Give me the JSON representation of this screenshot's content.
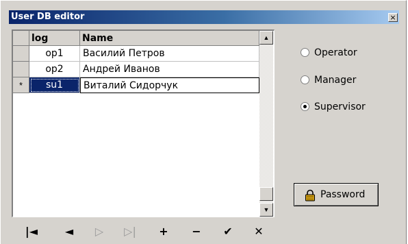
{
  "window": {
    "title": "User DB editor",
    "close_glyph": "×"
  },
  "grid": {
    "columns": [
      "log",
      "Name"
    ],
    "rows": [
      {
        "indicator": "",
        "log": "op1",
        "name": "Василий Петров"
      },
      {
        "indicator": "",
        "log": "op2",
        "name": "Андрей Иванов"
      },
      {
        "indicator": "*",
        "log": "su1",
        "name": "Виталий Сидорчук"
      }
    ],
    "selected_row": 2
  },
  "navigator": {
    "buttons": [
      {
        "name": "first-record-button",
        "glyph": "|◄",
        "enabled": true
      },
      {
        "name": "prior-record-button",
        "glyph": "◄",
        "enabled": true
      },
      {
        "name": "next-record-button",
        "glyph": "▷",
        "enabled": false
      },
      {
        "name": "last-record-button",
        "glyph": "▷|",
        "enabled": false
      },
      {
        "name": "insert-record-button",
        "glyph": "+",
        "enabled": true
      },
      {
        "name": "delete-record-button",
        "glyph": "−",
        "enabled": true
      },
      {
        "name": "post-edit-button",
        "glyph": "✔",
        "enabled": true
      },
      {
        "name": "cancel-edit-button",
        "glyph": "✕",
        "enabled": true
      }
    ]
  },
  "roles": {
    "options": [
      "Operator",
      "Manager",
      "Supervisor"
    ],
    "selected": "Supervisor"
  },
  "password_button": {
    "label": "Password",
    "icon": "padlock-icon"
  },
  "colors": {
    "face": "#d6d3ce",
    "title_start": "#0a246a",
    "title_end": "#a6caf0",
    "selection": "#0a246a"
  }
}
